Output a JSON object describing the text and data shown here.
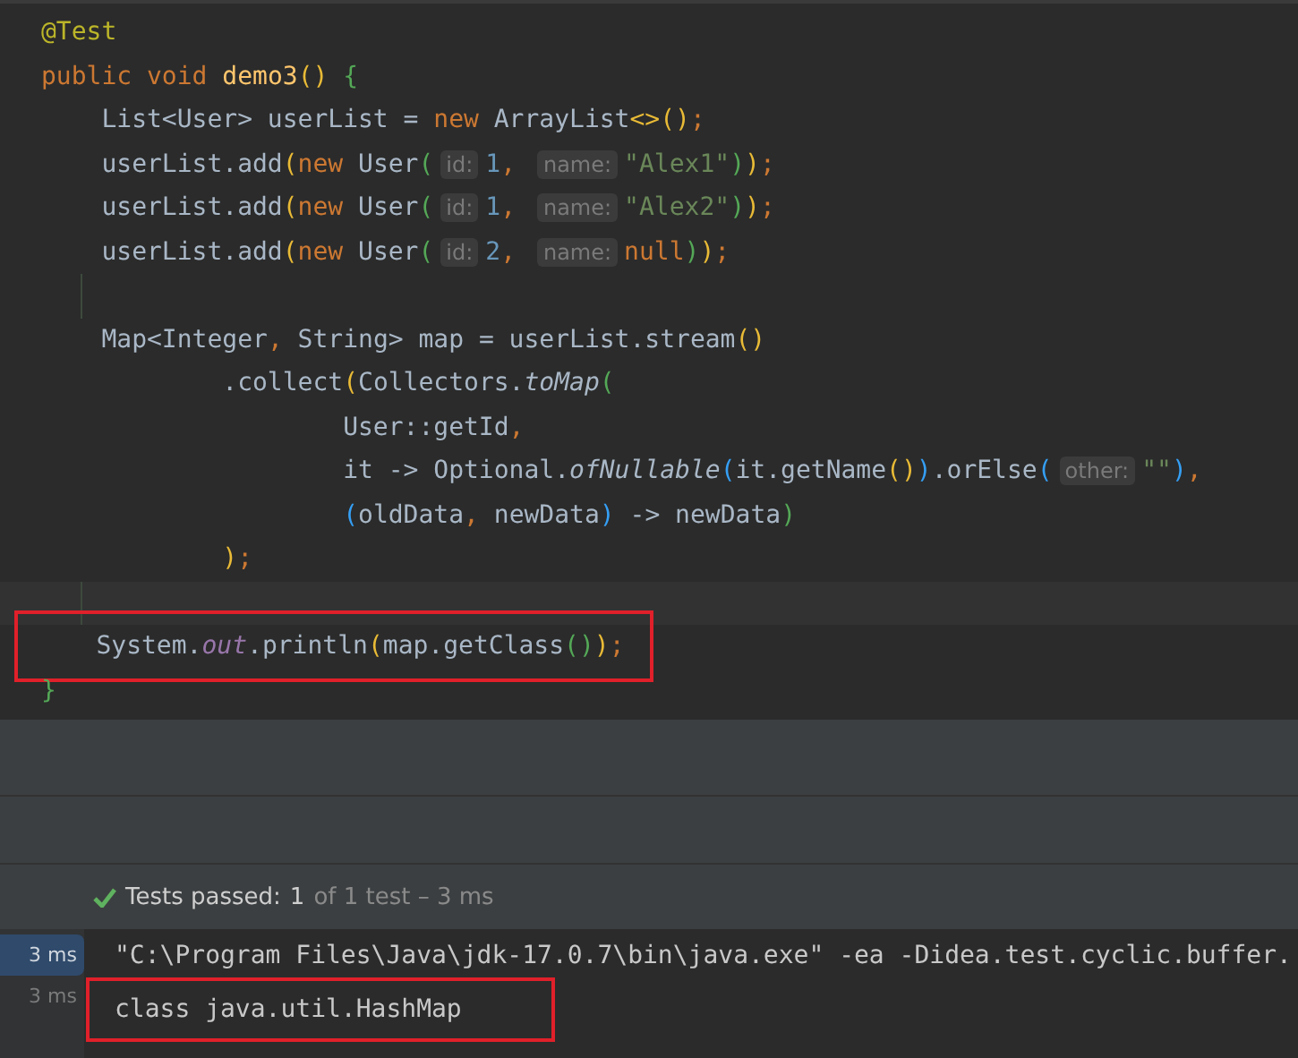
{
  "editor": {
    "lines": [
      {
        "tokens": [
          {
            "text": "@Test",
            "kind": "annotation"
          }
        ]
      },
      {
        "tokens": [
          {
            "text": "public void ",
            "kind": "keyword"
          },
          {
            "text": "demo3",
            "kind": "method"
          },
          {
            "text": "() ",
            "kind": "bracket1"
          },
          {
            "text": "{",
            "kind": "bracket2"
          }
        ]
      },
      {
        "tokens": [
          {
            "text": "    List<User> userList = ",
            "kind": "plain"
          },
          {
            "text": "new ",
            "kind": "keyword"
          },
          {
            "text": "ArrayList",
            "kind": "plain"
          },
          {
            "text": "<>()",
            "kind": "bracket1"
          },
          {
            "text": ";",
            "kind": "keyword"
          }
        ]
      },
      {
        "tokens": [
          {
            "text": "    userList.add",
            "kind": "plain"
          },
          {
            "text": "(",
            "kind": "bracket1"
          },
          {
            "text": "new ",
            "kind": "keyword"
          },
          {
            "text": "User",
            "kind": "plain"
          },
          {
            "text": "(",
            "kind": "bracket2"
          },
          {
            "text": "id:",
            "kind": "hint"
          },
          {
            "text": "1",
            "kind": "number"
          },
          {
            "text": ", ",
            "kind": "keyword"
          },
          {
            "text": "name:",
            "kind": "hint"
          },
          {
            "text": "\"Alex1\"",
            "kind": "string"
          },
          {
            "text": ")",
            "kind": "bracket2"
          },
          {
            "text": ")",
            "kind": "bracket1"
          },
          {
            "text": ";",
            "kind": "keyword"
          }
        ]
      },
      {
        "tokens": [
          {
            "text": "    userList.add",
            "kind": "plain"
          },
          {
            "text": "(",
            "kind": "bracket1"
          },
          {
            "text": "new ",
            "kind": "keyword"
          },
          {
            "text": "User",
            "kind": "plain"
          },
          {
            "text": "(",
            "kind": "bracket2"
          },
          {
            "text": "id:",
            "kind": "hint"
          },
          {
            "text": "1",
            "kind": "number"
          },
          {
            "text": ", ",
            "kind": "keyword"
          },
          {
            "text": "name:",
            "kind": "hint"
          },
          {
            "text": "\"Alex2\"",
            "kind": "string"
          },
          {
            "text": ")",
            "kind": "bracket2"
          },
          {
            "text": ")",
            "kind": "bracket1"
          },
          {
            "text": ";",
            "kind": "keyword"
          }
        ]
      },
      {
        "tokens": [
          {
            "text": "    userList.add",
            "kind": "plain"
          },
          {
            "text": "(",
            "kind": "bracket1"
          },
          {
            "text": "new ",
            "kind": "keyword"
          },
          {
            "text": "User",
            "kind": "plain"
          },
          {
            "text": "(",
            "kind": "bracket2"
          },
          {
            "text": "id:",
            "kind": "hint"
          },
          {
            "text": "2",
            "kind": "number"
          },
          {
            "text": ", ",
            "kind": "keyword"
          },
          {
            "text": "name:",
            "kind": "hint"
          },
          {
            "text": "null",
            "kind": "keyword"
          },
          {
            "text": ")",
            "kind": "bracket2"
          },
          {
            "text": ")",
            "kind": "bracket1"
          },
          {
            "text": ";",
            "kind": "keyword"
          }
        ]
      },
      {
        "kind": "blank"
      },
      {
        "tokens": [
          {
            "text": "    Map<Integer",
            "kind": "plain"
          },
          {
            "text": ", ",
            "kind": "keyword"
          },
          {
            "text": "String> map = userList.stream",
            "kind": "plain"
          },
          {
            "text": "()",
            "kind": "bracket1"
          }
        ]
      },
      {
        "tokens": [
          {
            "text": "            .collect",
            "kind": "plain"
          },
          {
            "text": "(",
            "kind": "bracket1"
          },
          {
            "text": "Collectors.",
            "kind": "plain"
          },
          {
            "text": "toMap",
            "kind": "static"
          },
          {
            "text": "(",
            "kind": "bracket2"
          }
        ]
      },
      {
        "tokens": [
          {
            "text": "                    User::getId",
            "kind": "plain"
          },
          {
            "text": ",",
            "kind": "keyword"
          }
        ]
      },
      {
        "tokens": [
          {
            "text": "                    it -> Optional.",
            "kind": "plain"
          },
          {
            "text": "ofNullable",
            "kind": "static"
          },
          {
            "text": "(",
            "kind": "bracket3"
          },
          {
            "text": "it.getName",
            "kind": "plain"
          },
          {
            "text": "()",
            "kind": "bracket1"
          },
          {
            "text": ")",
            "kind": "bracket3"
          },
          {
            "text": ".orElse",
            "kind": "plain"
          },
          {
            "text": "(",
            "kind": "bracket3"
          },
          {
            "text": "other:",
            "kind": "hint"
          },
          {
            "text": "\"\"",
            "kind": "string"
          },
          {
            "text": ")",
            "kind": "bracket3"
          },
          {
            "text": ",",
            "kind": "keyword"
          }
        ]
      },
      {
        "tokens": [
          {
            "text": "                    (",
            "kind": "bracket3"
          },
          {
            "text": "oldData",
            "kind": "plain"
          },
          {
            "text": ", ",
            "kind": "keyword"
          },
          {
            "text": "newData",
            "kind": "plain"
          },
          {
            "text": ")",
            "kind": "bracket3"
          },
          {
            "text": " -> newData",
            "kind": "plain"
          },
          {
            "text": ")",
            "kind": "bracket2"
          }
        ]
      },
      {
        "tokens": [
          {
            "text": "            )",
            "kind": "bracket1"
          },
          {
            "text": ";",
            "kind": "keyword"
          }
        ]
      },
      {
        "kind": "blank",
        "current": true
      },
      {
        "highlighted": true,
        "tokens": [
          {
            "text": "    System.",
            "kind": "plain"
          },
          {
            "text": "out",
            "kind": "field"
          },
          {
            "text": ".println",
            "kind": "plain"
          },
          {
            "text": "(",
            "kind": "bracket1"
          },
          {
            "text": "map.getClass",
            "kind": "plain"
          },
          {
            "text": "()",
            "kind": "bracket2"
          },
          {
            "text": ")",
            "kind": "bracket1"
          },
          {
            "text": ";",
            "kind": "keyword"
          }
        ]
      },
      {
        "tokens": [
          {
            "text": "}",
            "kind": "bracket2"
          }
        ]
      }
    ]
  },
  "test_status": {
    "label": "Tests passed:",
    "count": "1",
    "detail": "of 1 test – 3 ms"
  },
  "console": {
    "rows": [
      {
        "time": "3 ms",
        "text": "\"C:\\Program Files\\Java\\jdk-17.0.7\\bin\\java.exe\" -ea -Didea.test.cyclic.buffer.",
        "selected": true,
        "highlighted": false
      },
      {
        "time": "3 ms",
        "text": "class java.util.HashMap",
        "selected": false,
        "highlighted": true
      }
    ]
  }
}
